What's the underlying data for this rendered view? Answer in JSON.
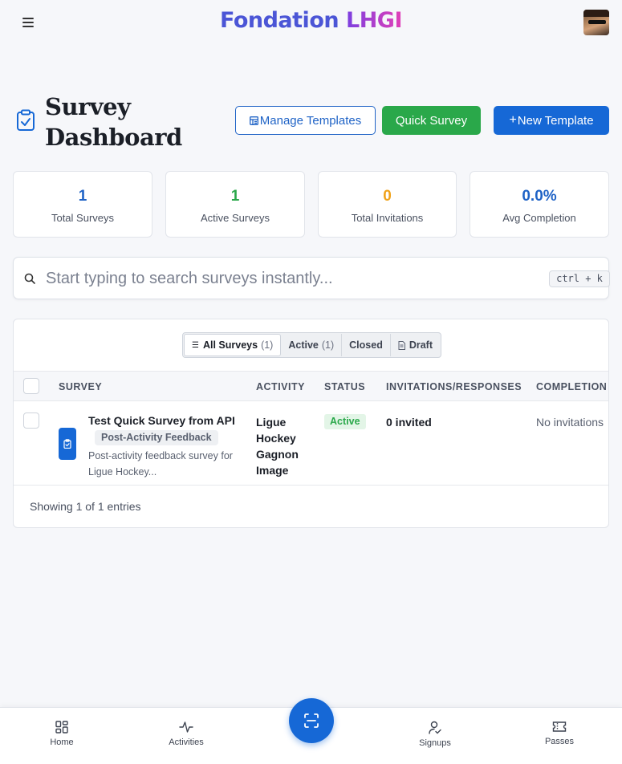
{
  "brand": {
    "part1": "Fondation",
    "part2": "LHGI"
  },
  "header": {
    "title": "Survey Dashboard",
    "manage_templates": "Manage Templates",
    "quick_survey": "Quick Survey",
    "new_template": "New Template",
    "new_template_prefix": "+"
  },
  "stats": [
    {
      "value": "1",
      "label": "Total Surveys"
    },
    {
      "value": "1",
      "label": "Active Surveys"
    },
    {
      "value": "0",
      "label": "Total Invitations"
    },
    {
      "value": "0.0%",
      "label": "Avg Completion"
    }
  ],
  "search": {
    "placeholder": "Start typing to search surveys instantly...",
    "shortcut": "ctrl + k"
  },
  "tabs": [
    {
      "label": "All Surveys",
      "count": "(1)"
    },
    {
      "label": "Active",
      "count": "(1)"
    },
    {
      "label": "Closed"
    },
    {
      "label": "Draft"
    }
  ],
  "columns": [
    "SURVEY",
    "ACTIVITY",
    "STATUS",
    "INVITATIONS/RESPONSES",
    "COMPLETION RATE"
  ],
  "rows": [
    {
      "title": "Test Quick Survey from API",
      "tag": "Post-Activity Feedback",
      "description": "Post-activity feedback survey for Ligue Hockey...",
      "activity": "Ligue Hockey Gagnon Image",
      "status": "Active",
      "invitations": "0 invited",
      "completion": "No invitations"
    }
  ],
  "footer": {
    "showing": "Showing 1 of 1 entries"
  },
  "bottom_nav": [
    {
      "label": "Home",
      "icon": "home-grid-icon"
    },
    {
      "label": "Activities",
      "icon": "activity-pulse-icon"
    },
    {
      "label": "Signups",
      "icon": "user-check-icon"
    },
    {
      "label": "Passes",
      "icon": "ticket-icon"
    }
  ],
  "colors": {
    "primary": "#1668d6",
    "success": "#2aa84a",
    "warning": "#f0a21a",
    "background": "#f6f7fa"
  }
}
